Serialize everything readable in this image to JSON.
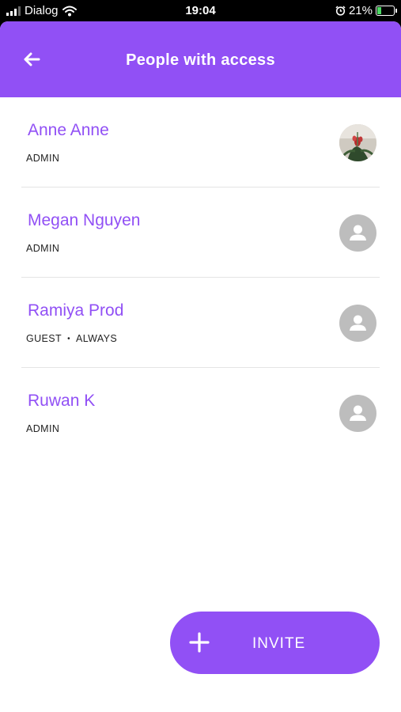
{
  "status_bar": {
    "carrier": "Dialog",
    "time": "19:04",
    "battery": "21%",
    "icons": [
      "signal-icon",
      "wifi-icon",
      "alarm-icon",
      "battery-charging-icon"
    ]
  },
  "header": {
    "title": "People with access",
    "back_icon": "arrow-left-icon",
    "color": "#9150f5"
  },
  "people": [
    {
      "name": "Anne Anne",
      "role": "ADMIN",
      "access": "",
      "avatar": "photo"
    },
    {
      "name": "Megan Nguyen",
      "role": "ADMIN",
      "access": "",
      "avatar": "default-person-icon"
    },
    {
      "name": "Ramiya Prod",
      "role": "GUEST",
      "access": "ALWAYS",
      "avatar": "default-person-icon"
    },
    {
      "name": "Ruwan K",
      "role": "ADMIN",
      "access": "",
      "avatar": "default-person-icon"
    }
  ],
  "invite_button": {
    "label": "INVITE",
    "icon": "plus-icon"
  }
}
